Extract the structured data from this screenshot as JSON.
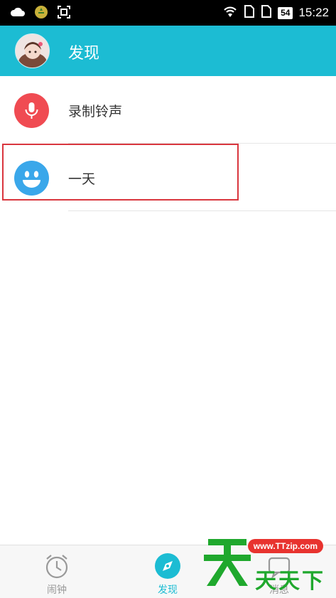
{
  "status_bar": {
    "battery": "54",
    "time": "15:22"
  },
  "header": {
    "title": "发现"
  },
  "list": {
    "items": [
      {
        "label": "录制铃声",
        "icon": "microphone-icon",
        "color": "#f04b52"
      },
      {
        "label": "一天",
        "icon": "smiley-icon",
        "color": "#3aa7ea"
      }
    ]
  },
  "bottom_nav": {
    "items": [
      {
        "label": "闹钟",
        "icon": "alarm-clock-icon"
      },
      {
        "label": "发现",
        "icon": "compass-icon",
        "active": true
      },
      {
        "label": "消息",
        "icon": "message-icon"
      }
    ]
  },
  "watermark": {
    "url": "www.TTzip.com",
    "text": "天天下載"
  },
  "colors": {
    "accent": "#1cbcd3",
    "highlight": "#d9363e",
    "record": "#f04b52",
    "oneday": "#3aa7ea"
  }
}
